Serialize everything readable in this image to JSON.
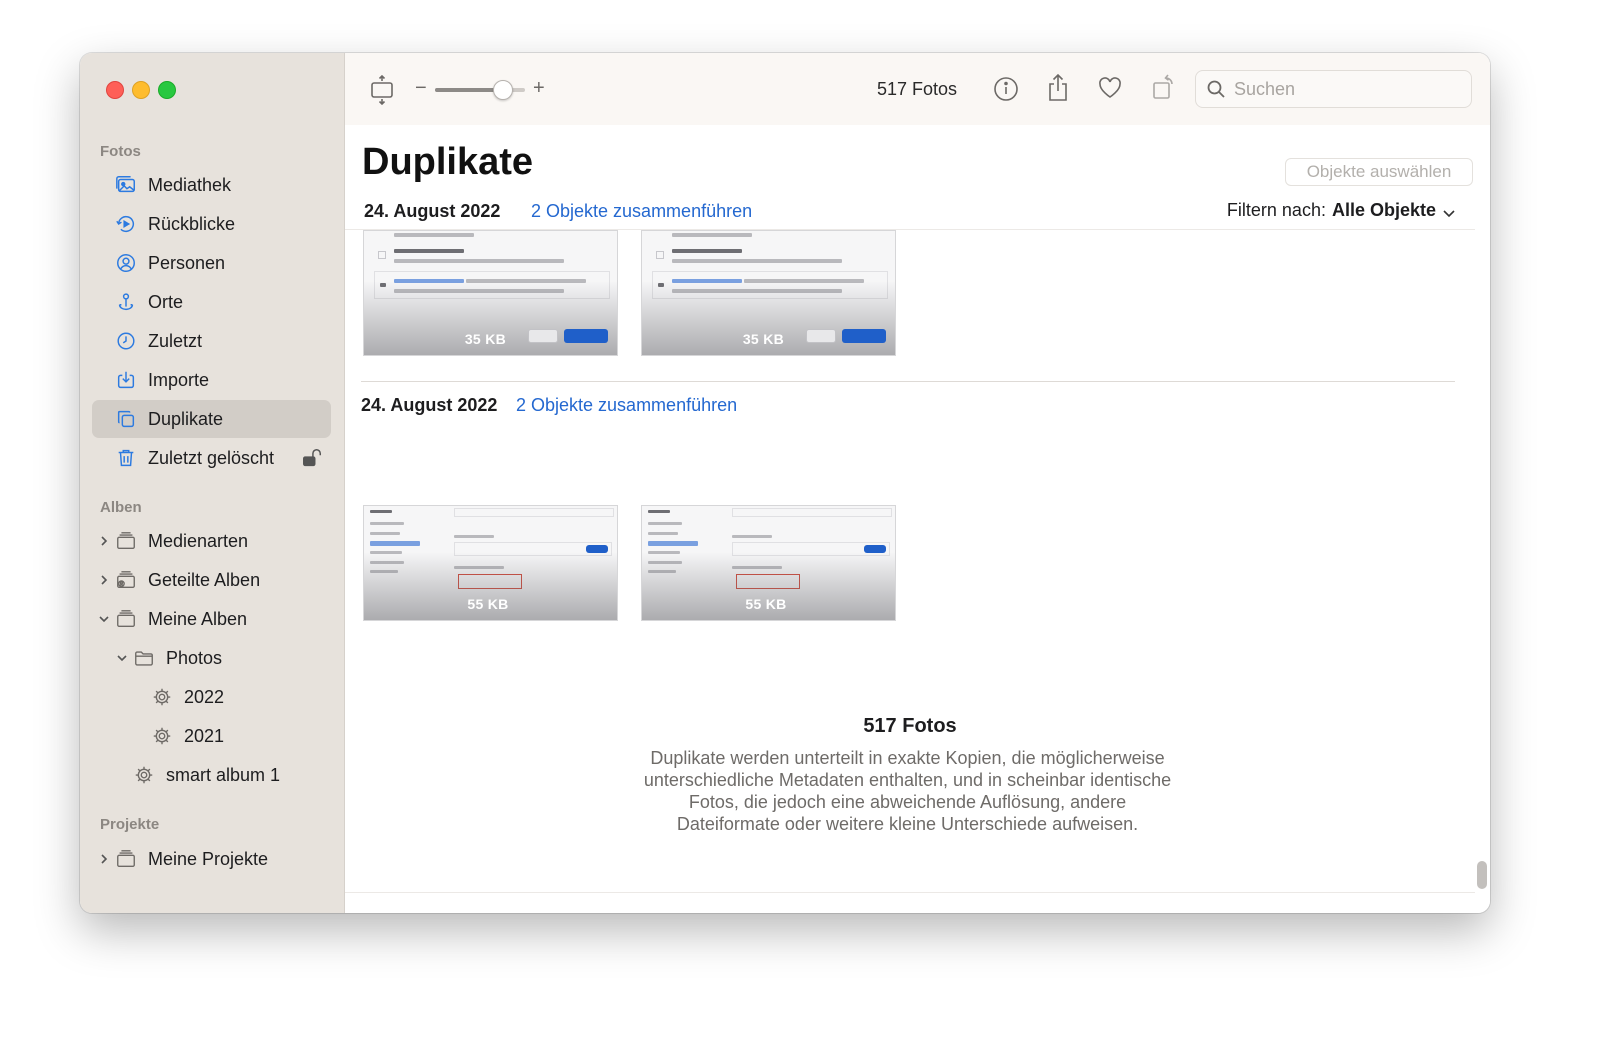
{
  "sidebar": {
    "sections": {
      "fotos": "Fotos",
      "alben": "Alben",
      "projekte": "Projekte"
    },
    "items": [
      {
        "label": "Mediathek",
        "icon": "library-icon"
      },
      {
        "label": "Rückblicke",
        "icon": "memories-icon"
      },
      {
        "label": "Personen",
        "icon": "people-icon"
      },
      {
        "label": "Orte",
        "icon": "places-icon"
      },
      {
        "label": "Zuletzt",
        "icon": "recent-icon"
      },
      {
        "label": "Importe",
        "icon": "imports-icon"
      },
      {
        "label": "Duplikate",
        "icon": "duplicates-icon",
        "selected": true
      },
      {
        "label": "Zuletzt gelöscht",
        "icon": "trash-icon"
      }
    ],
    "albums": [
      {
        "label": "Medienarten",
        "expanded": false
      },
      {
        "label": "Geteilte Alben",
        "expanded": false
      },
      {
        "label": "Meine Alben",
        "expanded": true
      },
      {
        "label": "Photos",
        "expanded": true
      },
      {
        "label": "2022"
      },
      {
        "label": "2021"
      },
      {
        "label": "smart album 1"
      }
    ],
    "projects": [
      {
        "label": "Meine Projekte",
        "expanded": false
      }
    ]
  },
  "toolbar": {
    "zoom_minus": "−",
    "zoom_plus": "+",
    "zoom_level": 0.75,
    "photo_count": "517 Fotos",
    "search_placeholder": "Suchen"
  },
  "main": {
    "title": "Duplikate",
    "select_button": "Objekte auswählen",
    "filter_label": "Filtern nach:",
    "filter_value": "Alle Objekte",
    "groups": [
      {
        "date": "24. August 2022",
        "merge": "2 Objekte zusammenführen",
        "thumbs": [
          {
            "size": "35 KB"
          },
          {
            "size": "35 KB"
          }
        ]
      },
      {
        "date": "24. August 2022",
        "merge": "2 Objekte zusammenführen",
        "thumbs": [
          {
            "size": "55 KB"
          },
          {
            "size": "55 KB"
          }
        ]
      }
    ],
    "footer_count": "517 Fotos",
    "footer_desc": "Duplikate werden unterteilt in exakte Kopien, die möglicherweise unterschiedliche Metadaten enthalten, und in scheinbar identische Fotos, die jedoch eine abweichende Auflösung, andere Dateiformate oder weitere kleine Unterschiede aufweisen."
  },
  "colors": {
    "accent": "#2c7ae0",
    "link": "#2468d0",
    "sidebar_bg": "#e7e2dc",
    "selected_bg": "#d2cdc7"
  }
}
